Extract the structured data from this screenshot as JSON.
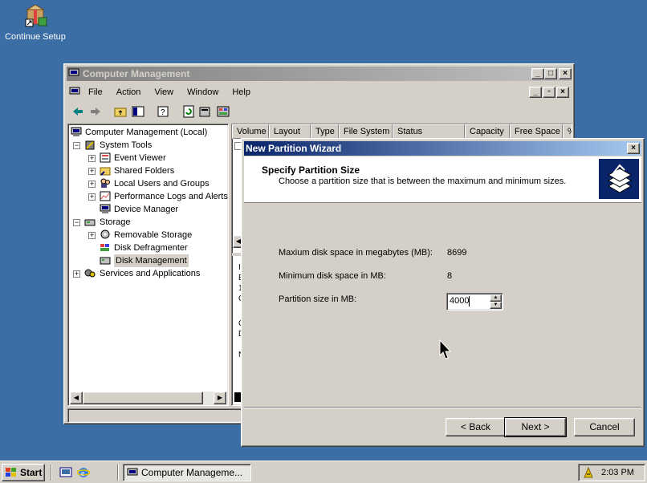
{
  "desktop": {
    "icon_label": "Continue Setup"
  },
  "mmc": {
    "title": "Computer Management",
    "menu": [
      "File",
      "Action",
      "View",
      "Window",
      "Help"
    ],
    "tree": [
      {
        "label": "Computer Management (Local)",
        "level": 0
      },
      {
        "label": "System Tools",
        "level": 1
      },
      {
        "label": "Event Viewer",
        "level": 2
      },
      {
        "label": "Shared Folders",
        "level": 2
      },
      {
        "label": "Local Users and Groups",
        "level": 2
      },
      {
        "label": "Performance Logs and Alerts",
        "level": 2
      },
      {
        "label": "Device Manager",
        "level": 2
      },
      {
        "label": "Storage",
        "level": 1
      },
      {
        "label": "Removable Storage",
        "level": 2
      },
      {
        "label": "Disk Defragmenter",
        "level": 2
      },
      {
        "label": "Disk Management",
        "level": 2
      },
      {
        "label": "Services and Applications",
        "level": 1
      }
    ],
    "columns": [
      "Volume",
      "Layout",
      "Type",
      "File System",
      "Status",
      "Capacity",
      "Free Space",
      "%"
    ],
    "partial_letters": [
      "I",
      "E",
      "1",
      "C",
      "C",
      "D",
      "N"
    ]
  },
  "wizard": {
    "title": "New Partition Wizard",
    "heading": "Specify Partition Size",
    "subheading": "Choose a partition size that is between the maximum and minimum sizes.",
    "max_label": "Maxium disk space in megabytes (MB):",
    "max_value": "8699",
    "min_label": "Minimum disk space in MB:",
    "min_value": "8",
    "size_label": "Partition size in MB:",
    "size_value": "4000",
    "back_label": "< Back",
    "next_label": "Next >",
    "cancel_label": "Cancel"
  },
  "taskbar": {
    "start_label": "Start",
    "task_label": "Computer Manageme...",
    "clock": "2:03 PM"
  },
  "colors": {
    "desktop": "#3a6ea5",
    "title_active_start": "#0a246a",
    "title_active_end": "#a6caf0",
    "title_inactive_start": "#808080",
    "title_inactive_end": "#c0c0c0",
    "face": "#d4d0c8"
  }
}
